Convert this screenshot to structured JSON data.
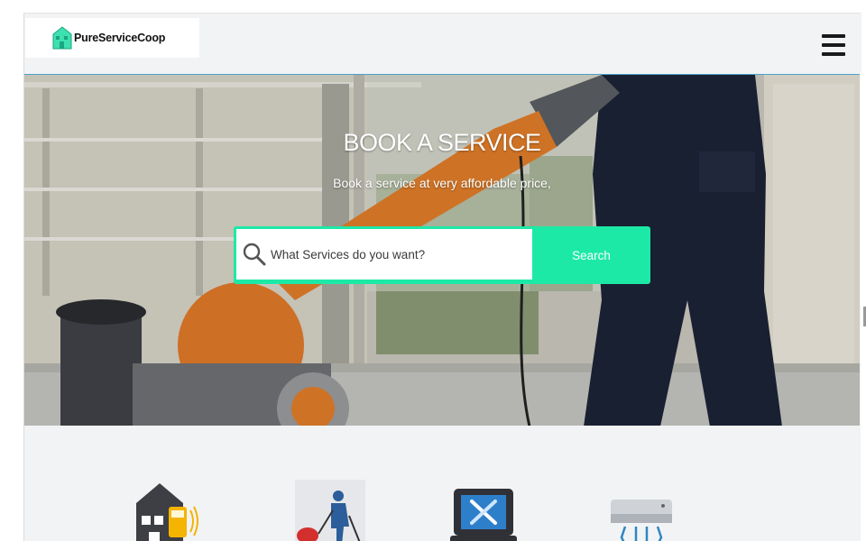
{
  "header": {
    "logo_text": "PureServiceCoop",
    "menu_icon": "hamburger-menu-icon"
  },
  "hero": {
    "title": "BOOK A SERVICE",
    "subtitle": "Book a service at very affordable price,",
    "search": {
      "placeholder": "What Services do you want?",
      "value": "",
      "button_label": "Search"
    }
  },
  "services": [
    {
      "name": "smart-home-icon"
    },
    {
      "name": "cleaning-service-icon"
    },
    {
      "name": "computer-repair-icon"
    },
    {
      "name": "air-conditioner-icon"
    }
  ],
  "colors": {
    "accent": "#1de9a6",
    "page_bg": "#f2f3f5",
    "hamburger": "#1a1a1a"
  }
}
